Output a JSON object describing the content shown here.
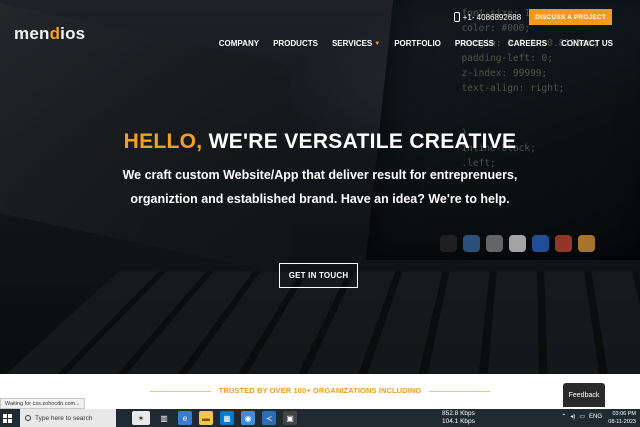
{
  "brand": {
    "logo_prefix": "men",
    "logo_accent": "d",
    "logo_suffix": "ios"
  },
  "header": {
    "phone": "+1- 4086892688",
    "cta_label": "DISCUSS A PROJECT",
    "nav": [
      "COMPANY",
      "PRODUCTS",
      "SERVICES",
      "PORTFOLIO",
      "PROCESS",
      "CAREERS",
      "CONTACT US"
    ]
  },
  "hero": {
    "headline_accent": "HELLO,",
    "headline_rest": " WE'RE VERSATILE CREATIVE",
    "sub_line1": "We craft custom Website/App that deliver result for entreprenuers,",
    "sub_line2": "organiztion and established brand. Have an idea? We're to help.",
    "button_label": "GET IN TOUCH"
  },
  "trusted": {
    "label": "TRUSTED BY OVER 100+ ORGANIZATIONS INCLUDING"
  },
  "feedback_label": "Feedback",
  "status_text": "Waiting for css.zohocdn.com...",
  "taskbar": {
    "search_placeholder": "Type here to search",
    "net_up": "852.8 Kbps",
    "net_down": "104.1 Kbps",
    "lang": "ENG",
    "time": "03:06 PM",
    "date": "08-11-2023"
  },
  "colors": {
    "accent": "#f29a1b",
    "taskbar": "#202a33"
  }
}
